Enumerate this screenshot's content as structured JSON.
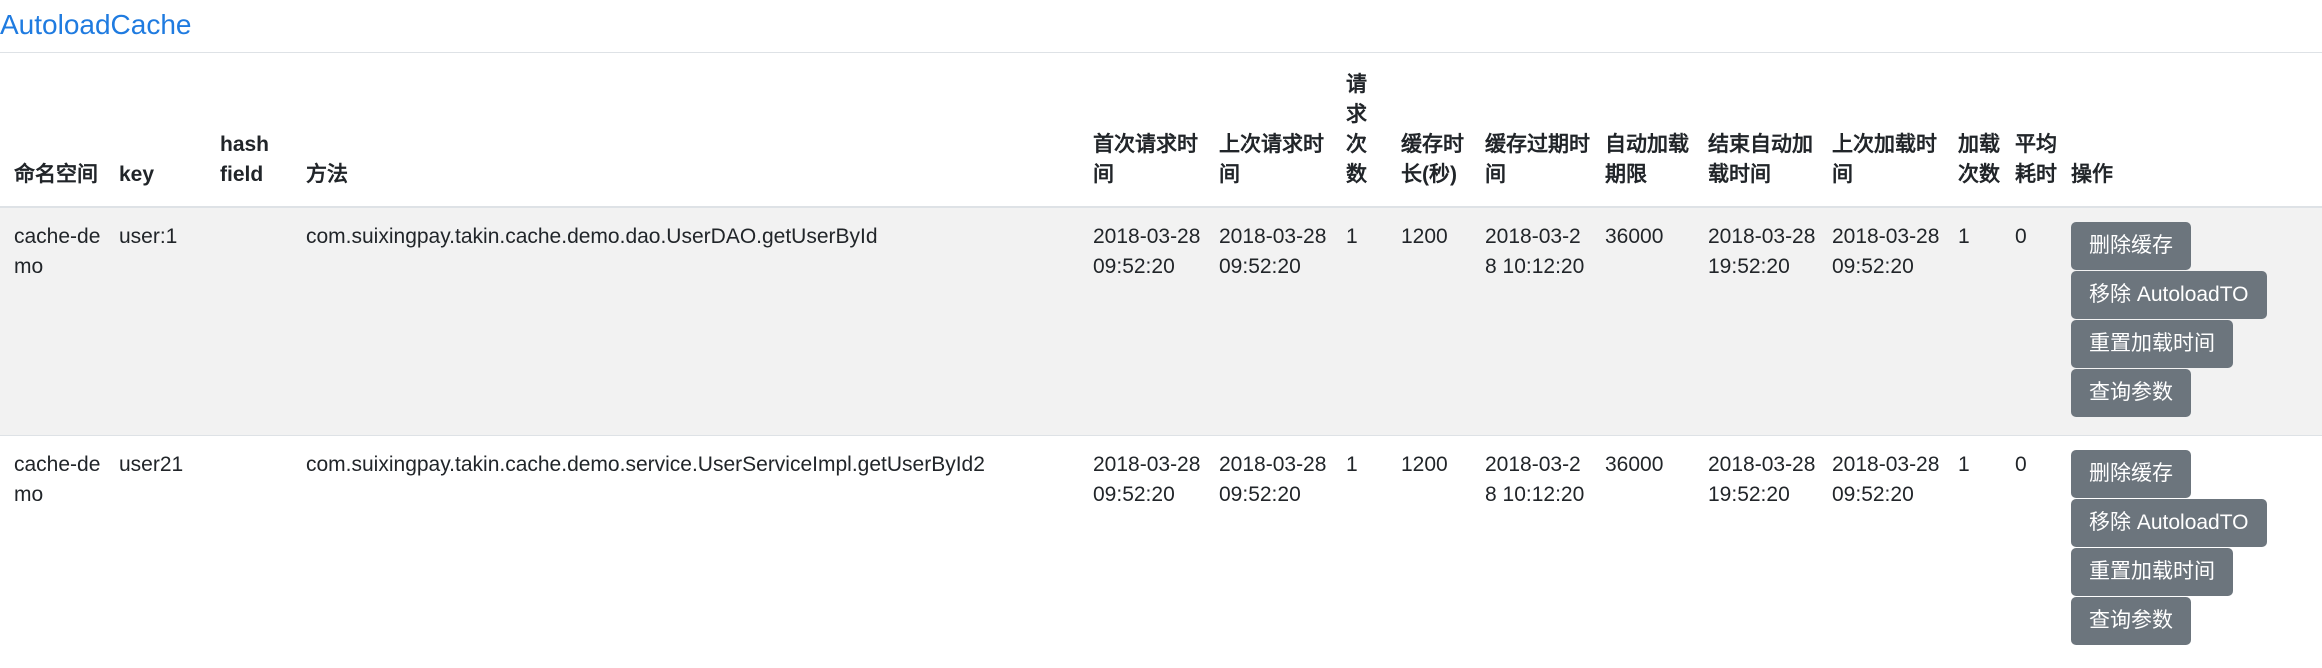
{
  "brand": "AutoloadCache",
  "columns": [
    "命名空间",
    "key",
    "hash field",
    "方法",
    "首次请求时间",
    "上次请求时间",
    "请求次数",
    "缓存时长(秒)",
    "缓存过期时间",
    "自动加载期限",
    "结束自动加载时间",
    "上次加载时间",
    "加载次数",
    "平均耗时",
    "操作"
  ],
  "rows": [
    {
      "namespace": "cache-demo",
      "key": "user:1",
      "hash_field": "",
      "method": "com.suixingpay.takin.cache.demo.dao.UserDAO.getUserById",
      "first_request_time": "2018-03-28 09:52:20",
      "last_request_time": "2018-03-28 09:52:20",
      "request_count": "1",
      "cache_duration": "1200",
      "expire_time": "2018-03-28 10:12:20",
      "autoload_period": "36000",
      "autoload_end_time": "2018-03-28 19:52:20",
      "last_load_time": "2018-03-28 09:52:20",
      "load_count": "1",
      "avg_time": "0",
      "actions": [
        "删除缓存",
        "移除 AutoloadTO",
        "重置加载时间",
        "查询参数"
      ]
    },
    {
      "namespace": "cache-demo",
      "key": "user21",
      "hash_field": "",
      "method": "com.suixingpay.takin.cache.demo.service.UserServiceImpl.getUserById2",
      "first_request_time": "2018-03-28 09:52:20",
      "last_request_time": "2018-03-28 09:52:20",
      "request_count": "1",
      "cache_duration": "1200",
      "expire_time": "2018-03-28 10:12:20",
      "autoload_period": "36000",
      "autoload_end_time": "2018-03-28 19:52:20",
      "last_load_time": "2018-03-28 09:52:20",
      "load_count": "1",
      "avg_time": "0",
      "actions": [
        "删除缓存",
        "移除 AutoloadTO",
        "重置加载时间",
        "查询参数"
      ]
    }
  ],
  "colors": {
    "brand": "#1f7be0",
    "button_bg": "#6c757d",
    "row_stripe": "#f2f2f2",
    "border": "#dee2e6"
  }
}
